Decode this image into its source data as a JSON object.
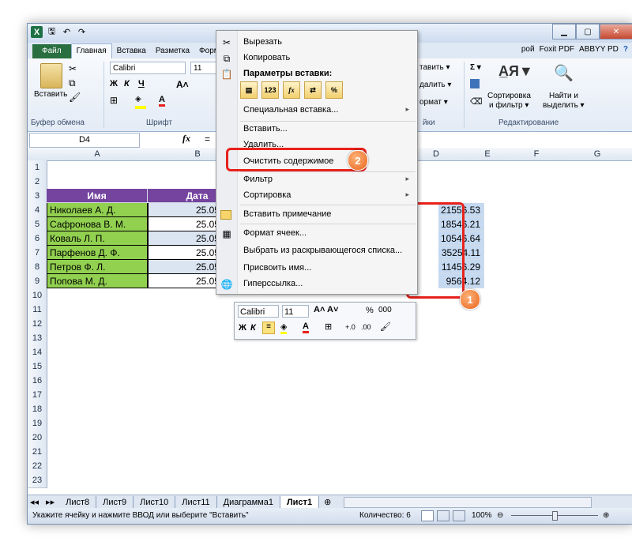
{
  "qat": {
    "logo": "X",
    "save": "🖫",
    "undo": "↶",
    "redo": "↷"
  },
  "ribbon_tabs": [
    "Файл",
    "Главная",
    "Вставка",
    "Разметка",
    "Форм"
  ],
  "ribbon_tabs_right": [
    "рой",
    "Foxit PDF",
    "ABBYY PD"
  ],
  "ribbon": {
    "paste_label": "Вставить",
    "clipboard_group": "Буфер обмена",
    "font_name": "Calibri",
    "font_size": "11",
    "font_group": "Шрифт",
    "bold": "Ж",
    "italic": "К",
    "underline": "Ч",
    "insert_btn": "тавить ▾",
    "delete_btn": "далить ▾",
    "format_btn": "ормат ▾",
    "cells_group": "йки",
    "sort_label": "Сортировка",
    "sort_label2": "и фильтр ▾",
    "find_label": "Найти и",
    "find_label2": "выделить ▾",
    "edit_group": "Редактирование",
    "sigma": "Σ ▾"
  },
  "formula_bar": {
    "name_box": "D4",
    "fx": "fx",
    "formula": "="
  },
  "columns": [
    {
      "id": "A",
      "label": "A"
    },
    {
      "id": "B",
      "label": "B"
    },
    {
      "id": "D",
      "label": "D"
    },
    {
      "id": "E",
      "label": "E"
    },
    {
      "id": "F",
      "label": "F"
    },
    {
      "id": "G",
      "label": "G"
    }
  ],
  "rows": [
    "1",
    "2",
    "3",
    "4",
    "5",
    "6",
    "7",
    "8",
    "9",
    "10",
    "11",
    "12",
    "13",
    "14",
    "15",
    "16",
    "17",
    "18",
    "19",
    "20",
    "21",
    "22",
    "23"
  ],
  "table": {
    "header_name": "Имя",
    "header_date": "Дата",
    "records": [
      {
        "name": "Николаев А. Д.",
        "date": "25.05.2016",
        "value": "21556.53"
      },
      {
        "name": "Сафронова В. М.",
        "date": "25.05.2016",
        "value": "18546.21"
      },
      {
        "name": "Коваль Л. П.",
        "date": "25.05.2016",
        "value": "10546.64"
      },
      {
        "name": "Парфенов Д. Ф.",
        "date": "25.05.2016",
        "value": "35254.11"
      },
      {
        "name": "Петров Ф. Л.",
        "date": "25.05.2016",
        "value": "11456.29"
      },
      {
        "name": "Попова М. Д.",
        "date": "25.05.2016",
        "value": "9564.12"
      }
    ]
  },
  "context_menu": {
    "cut": "Вырезать",
    "copy": "Копировать",
    "paste_options": "Параметры вставки:",
    "paste_special": "Специальная вставка...",
    "insert": "Вставить...",
    "delete": "Удалить...",
    "clear": "Очистить содержимое",
    "filter": "Фильтр",
    "sort": "Сортировка",
    "insert_note": "Вставить примечание",
    "format_cells": "Формат ячеек...",
    "pick_list": "Выбрать из раскрывающегося списка...",
    "name": "Присвоить имя...",
    "hyperlink": "Гиперссылка..."
  },
  "mini_toolbar": {
    "font": "Calibri",
    "size": "11",
    "percent": "%",
    "thousands": "000",
    "bold": "Ж",
    "italic": "К"
  },
  "sheet_tabs": [
    "Лист8",
    "Лист9",
    "Лист10",
    "Лист11",
    "Диаграмма1",
    "Лист1"
  ],
  "status": {
    "message": "Укажите ячейку и нажмите ВВОД или выберите \"Вставить\"",
    "count": "Количество: 6",
    "zoom": "100%"
  },
  "badges": {
    "one": "1",
    "two": "2"
  },
  "colors": {
    "accent_purple": "#74449f",
    "name_green": "#92d050",
    "highlight_red": "#e8211c",
    "badge_orange": "#e8661c"
  }
}
